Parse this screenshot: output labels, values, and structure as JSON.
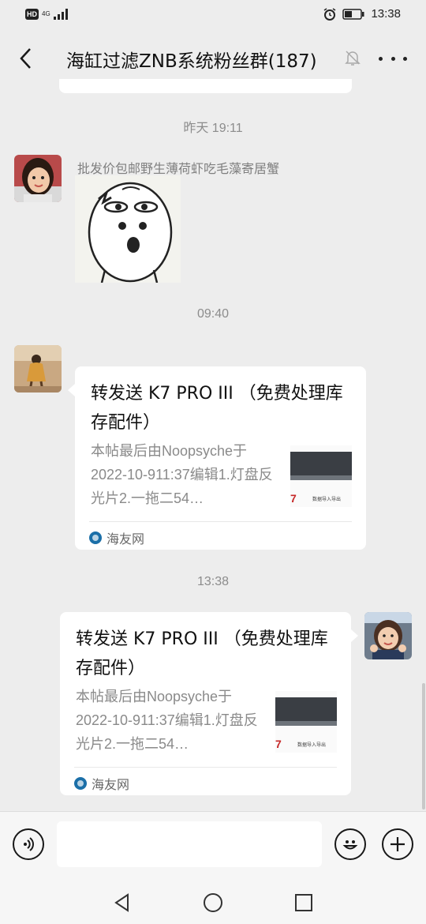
{
  "status_bar": {
    "hd_label": "HD",
    "network_label": "4G",
    "time": "13:38"
  },
  "header": {
    "title": "海缸过滤ZNB系统粉丝群(187)"
  },
  "messages": {
    "time_1": "昨天 19:11",
    "sender_1_name": "批发价包邮野生薄荷虾吃毛藻寄居蟹",
    "time_2": "09:40",
    "card_1": {
      "title": "转发送 K7 PRO III （免费处理库存配件）",
      "desc": "本帖最后由Noopsyche于2022-10-911:37编辑1.灯盘反光片2.一拖二54…",
      "thumb_label": "7",
      "thumb_text": "数据导入导出",
      "source": "海友网"
    },
    "time_3": "13:38",
    "card_2": {
      "title": "转发送 K7 PRO III （免费处理库存配件）",
      "desc": "本帖最后由Noopsyche于2022-10-911:37编辑1.灯盘反光片2.一拖二54…",
      "thumb_label": "7",
      "thumb_text": "数据导入导出",
      "source": "海友网"
    }
  },
  "input": {
    "placeholder": ""
  },
  "colors": {
    "background": "#ededed",
    "card": "#ffffff",
    "time_text": "#8c8c8c",
    "source_icon": "#1b6fa8"
  },
  "icons": [
    "back-arrow-icon",
    "mute-bell-icon",
    "more-dots-icon",
    "voice-icon",
    "emoji-icon",
    "plus-icon",
    "nav-back-icon",
    "nav-home-icon",
    "nav-recents-icon"
  ]
}
